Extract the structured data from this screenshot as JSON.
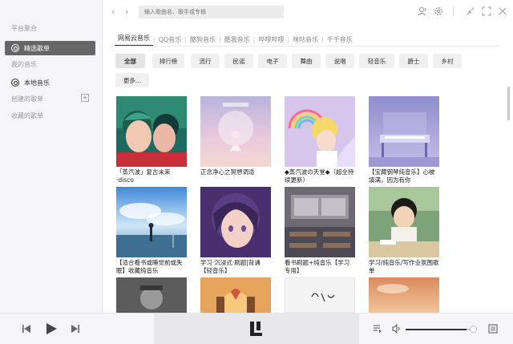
{
  "sidebar": {
    "platform_label": "平台聚合",
    "items": [
      {
        "label": "精选歌单",
        "active": true
      },
      {
        "label": "我的音乐"
      },
      {
        "label": "本地音乐"
      },
      {
        "label": "创建的歌单"
      },
      {
        "label": "收藏的歌单"
      }
    ]
  },
  "search": {
    "placeholder": "输入歌曲名、歌手或专辑"
  },
  "tabs": [
    "网易云音乐",
    "QQ音乐",
    "酷狗音乐",
    "酷我音乐",
    "哔哩哔哩",
    "咪咕音乐",
    "千千音乐"
  ],
  "chips": [
    "全部",
    "排行榜",
    "流行",
    "民谣",
    "电子",
    "舞曲",
    "说唱",
    "轻音乐",
    "爵士",
    "乡村",
    "更多..."
  ],
  "playlists": [
    {
      "title": "「蒸汽波」复古未来·disco"
    },
    {
      "title": "正念净心之冥想调适"
    },
    {
      "title": "◆蒸汽波の天堂◆（超全持续更新）"
    },
    {
      "title": "【宝藏钢琴纯音乐】心被填满，因为有你"
    },
    {
      "title": "【适合看书或睡觉前或失眠】收藏纯音乐"
    },
    {
      "title": "学习·沉浸式·刷题|背诵【轻音乐】"
    },
    {
      "title": "看书刷题+纯音乐【学习专用】"
    },
    {
      "title": "学习/纯音乐/写作业氛围歌单"
    },
    {
      "title": ""
    },
    {
      "title": ""
    },
    {
      "title": ""
    },
    {
      "title": ""
    }
  ],
  "colors": {
    "active_sidebar": "#666666",
    "accent": "#333333"
  },
  "player": {
    "volume": 0.9
  }
}
